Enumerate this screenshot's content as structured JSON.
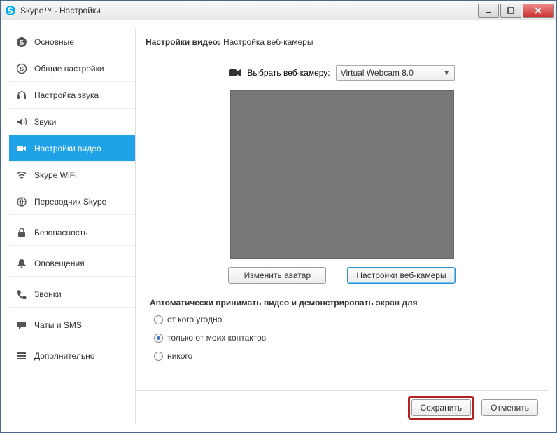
{
  "window": {
    "title": "Skype™ - Настройки"
  },
  "sidebar": {
    "items": [
      {
        "label": "Основные",
        "icon": "skype"
      },
      {
        "label": "Общие настройки",
        "icon": "skype"
      },
      {
        "label": "Настройка звука",
        "icon": "headset"
      },
      {
        "label": "Звуки",
        "icon": "speaker"
      },
      {
        "label": "Настройки видео",
        "icon": "camera",
        "active": true
      },
      {
        "label": "Skype WiFi",
        "icon": "wifi"
      },
      {
        "label": "Переводчик Skype",
        "icon": "globe"
      },
      {
        "label": "Безопасность",
        "icon": "lock"
      },
      {
        "label": "Оповещения",
        "icon": "bell"
      },
      {
        "label": "Звонки",
        "icon": "phone"
      },
      {
        "label": "Чаты и SMS",
        "icon": "chat"
      },
      {
        "label": "Дополнительно",
        "icon": "list"
      }
    ]
  },
  "header": {
    "title": "Настройки видео:",
    "subtitle": "Настройка веб-камеры"
  },
  "webcam": {
    "label": "Выбрать веб-камеру:",
    "selected": "Virtual Webcam 8.0"
  },
  "buttons": {
    "change_avatar": "Изменить аватар",
    "webcam_settings": "Настройки веб-камеры",
    "save": "Сохранить",
    "cancel": "Отменить"
  },
  "auto_accept": {
    "heading": "Автоматически принимать видео и демонстрировать экран для",
    "options": [
      {
        "label": "от кого угодно",
        "checked": false
      },
      {
        "label": "только от моих контактов",
        "checked": true
      },
      {
        "label": "никого",
        "checked": false
      }
    ]
  }
}
